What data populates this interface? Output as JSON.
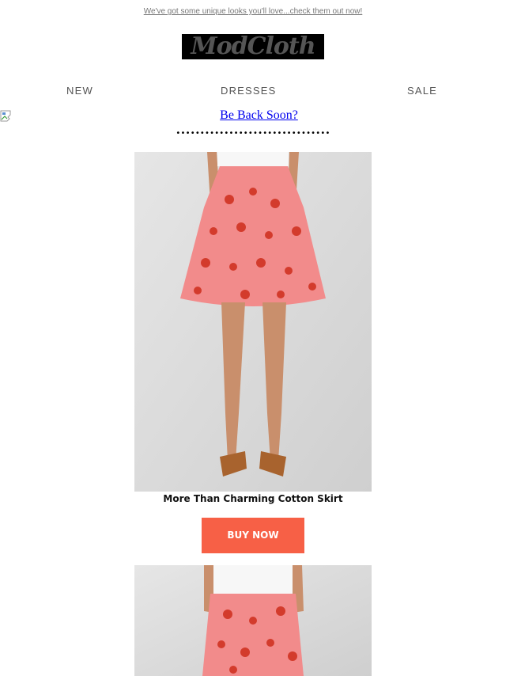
{
  "preheader": {
    "text": "We've got some unique looks you'll love...check them out now!"
  },
  "logo": {
    "text": "ModCloth"
  },
  "nav": {
    "items": [
      {
        "label": "NEW"
      },
      {
        "label": "DRESSES"
      },
      {
        "label": "SALE"
      }
    ]
  },
  "banner": {
    "link_text": "Be Back Soon?"
  },
  "divider": {
    "dots": "••••••••••••••••••••••••••••••••"
  },
  "products": [
    {
      "title": "More Than Charming Cotton Skirt",
      "button_label": "BUY NOW"
    }
  ],
  "colors": {
    "accent": "#f76046",
    "link": "#0000ee",
    "logo_bg": "#000000",
    "product_pink": "#f28b8b"
  },
  "icons": {
    "broken_image": "broken-image-icon"
  }
}
